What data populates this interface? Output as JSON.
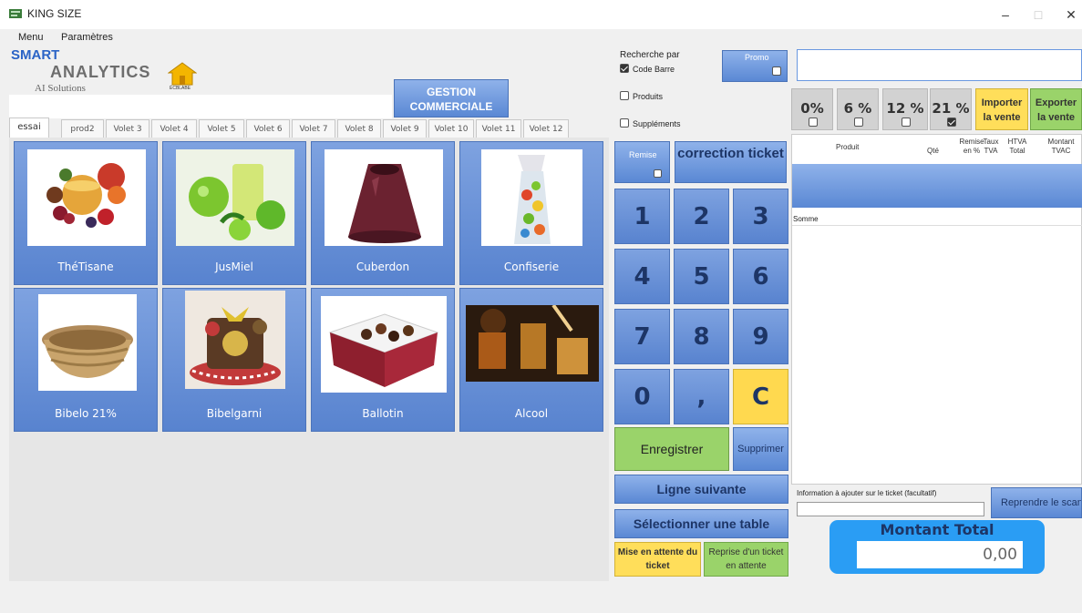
{
  "window": {
    "title": "KING SIZE",
    "minimize": "–",
    "maximize": "□",
    "close": "✕"
  },
  "menu": {
    "items": [
      "Menu",
      "Paramètres"
    ]
  },
  "logo": {
    "line1": "SMART",
    "line2": "ANALYTICS",
    "line3": "AI Solutions",
    "house_label": "ÉCBLABE"
  },
  "gestion": {
    "line1": "GESTION",
    "line2": "COMMERCIALE"
  },
  "tabs": [
    "essai",
    "prod2",
    "Volet 3",
    "Volet 4",
    "Volet 5",
    "Volet 6",
    "Volet 7",
    "Volet 8",
    "Volet 9",
    "Volet 10",
    "Volet 11",
    "Volet 12"
  ],
  "products": [
    {
      "label": "ThéTisane",
      "icon": "tea-fruits-image"
    },
    {
      "label": "JusMiel",
      "icon": "juice-apples-image"
    },
    {
      "label": "Cuberdon",
      "icon": "cuberdon-candy-image"
    },
    {
      "label": "Confiserie",
      "icon": "candy-bag-image"
    },
    {
      "label": "Bibelo 21%",
      "icon": "basket-image"
    },
    {
      "label": "Bibelgarni",
      "icon": "gift-basket-image"
    },
    {
      "label": "Ballotin",
      "icon": "chocolate-box-image"
    },
    {
      "label": "Alcool",
      "icon": "liquor-glass-image"
    }
  ],
  "search": {
    "title": "Recherche par",
    "code_barre": "Code Barre",
    "produits": "Produits",
    "supplements": "Suppléments",
    "code_barre_checked": true,
    "promo": "Promo",
    "value": ""
  },
  "tva": {
    "options": [
      "0%",
      "6 %",
      "12 %",
      "21 %"
    ],
    "checked": "21 %"
  },
  "import": {
    "line1": "Importer",
    "line2": "la vente"
  },
  "export": {
    "line1": "Exporter",
    "line2": "la vente"
  },
  "keypad": {
    "remise": "Remise",
    "correction": "correction ticket",
    "keys": [
      "1",
      "2",
      "3",
      "4",
      "5",
      "6",
      "7",
      "8",
      "9",
      "0",
      ",",
      "C"
    ],
    "enregistrer": "Enregistrer",
    "supprimer": "Supprimer",
    "ligne_suivante": "Ligne suivante",
    "selectionner_table": "Sélectionner une table",
    "mise_en_attente": "Mise en attente du ticket",
    "reprise_ticket": "Reprise d'un ticket en attente"
  },
  "ticket": {
    "headers": {
      "produit": "Produit",
      "qte": "Qté",
      "remise": "Remise en %",
      "taux": "Taux TVA",
      "htva": "HTVA Total",
      "montant": "Montant TVAC"
    },
    "somme": "Somme",
    "info_label": "Information à ajouter sur le ticket (facultatif)",
    "info_value": "",
    "reprendre": "Reprendre le scan",
    "total_label": "Montant Total",
    "total_value": "0,00"
  },
  "colors": {
    "accent_blue": "#5a88d4",
    "yellow": "#ffde5a",
    "green": "#9ad36a",
    "total_blue": "#2a9df4"
  }
}
